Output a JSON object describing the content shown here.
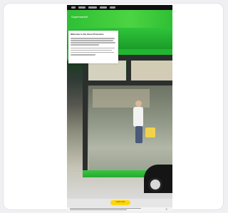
{
  "app": {
    "title": "Supermarket"
  },
  "modal": {
    "title": "Welcome to the Store Promotion"
  },
  "cta": {
    "label": "Learn more"
  },
  "cookie": {
    "close": "×"
  },
  "colors": {
    "brand_green": "#2fbf35",
    "cta_yellow": "#ffd60a",
    "statusbar": "#0f0f0f"
  }
}
